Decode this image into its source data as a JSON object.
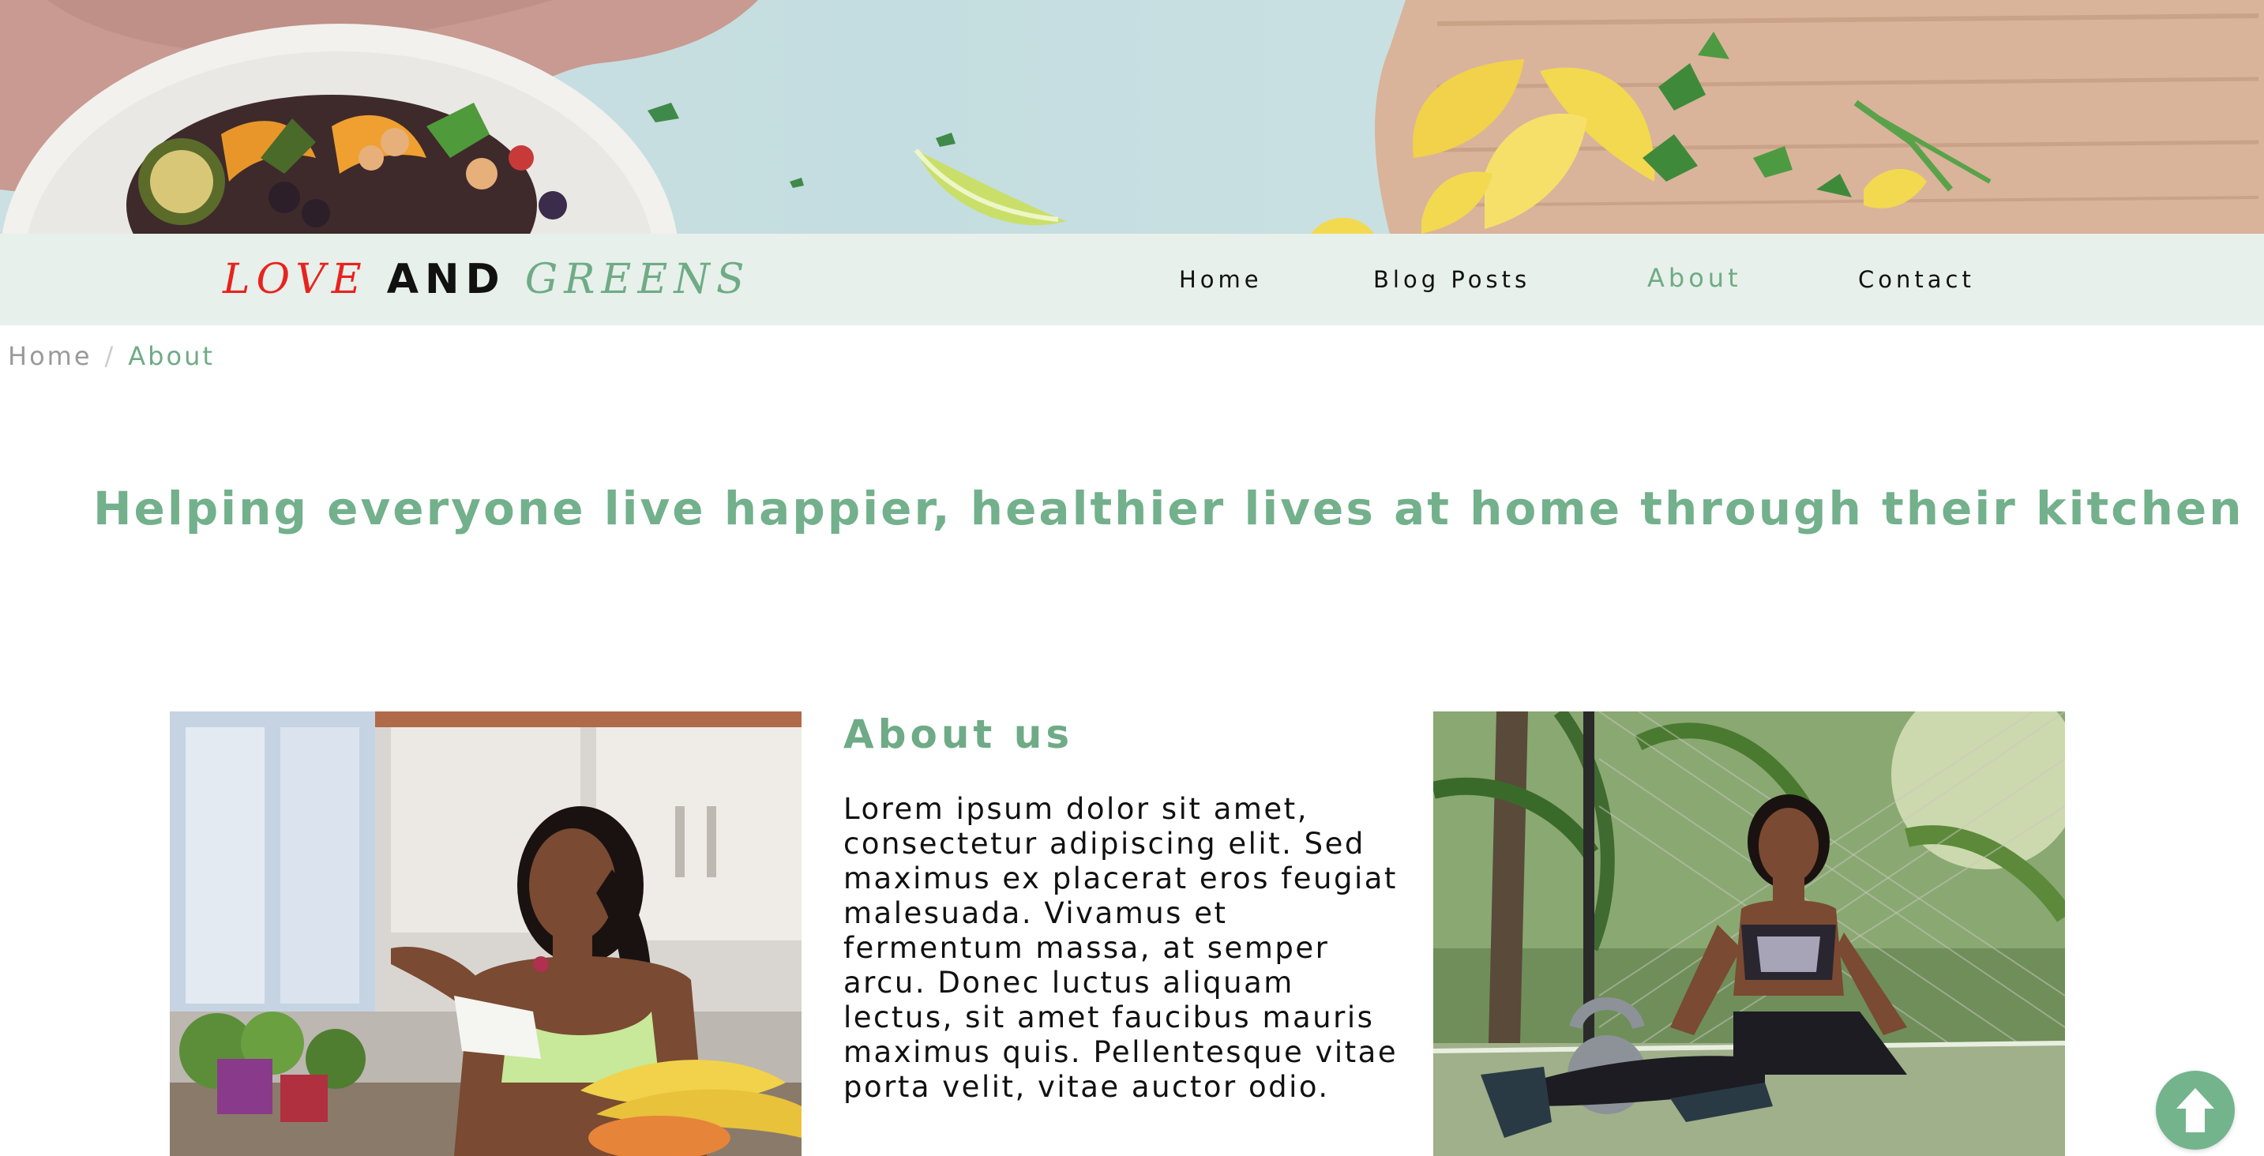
{
  "brand": {
    "love": "LOVE",
    "and": "AND",
    "greens": "GREENS"
  },
  "nav": {
    "items": [
      {
        "label": "Home"
      },
      {
        "label": "Blog Posts"
      },
      {
        "label": "About",
        "active": true
      },
      {
        "label": "Contact"
      }
    ]
  },
  "breadcrumb": {
    "home": "Home",
    "separator": "/",
    "current": "About"
  },
  "tagline": "Helping everyone live happier, healthier lives at home through their kitchen",
  "about": {
    "heading": "About us",
    "body_lines": [
      "Lorem ipsum dolor sit amet,",
      "consectetur adipiscing elit. Sed",
      "maximus ex placerat eros feugiat",
      "malesuada. Vivamus et",
      "fermentum massa, at semper",
      "arcu. Donec luctus aliquam",
      "lectus, sit amet faucibus mauris",
      "maximus quis. Pellentesque vitae",
      "porta velit, vitae auctor odio."
    ]
  },
  "icons": {
    "scroll_top": "arrow-up-icon"
  },
  "colors": {
    "accent_green": "#6fab86",
    "navbar_bg": "#e7f0ea",
    "brand_red": "#e8231f",
    "text_dark": "#111111",
    "breadcrumb_gray": "#9a9a9a"
  }
}
